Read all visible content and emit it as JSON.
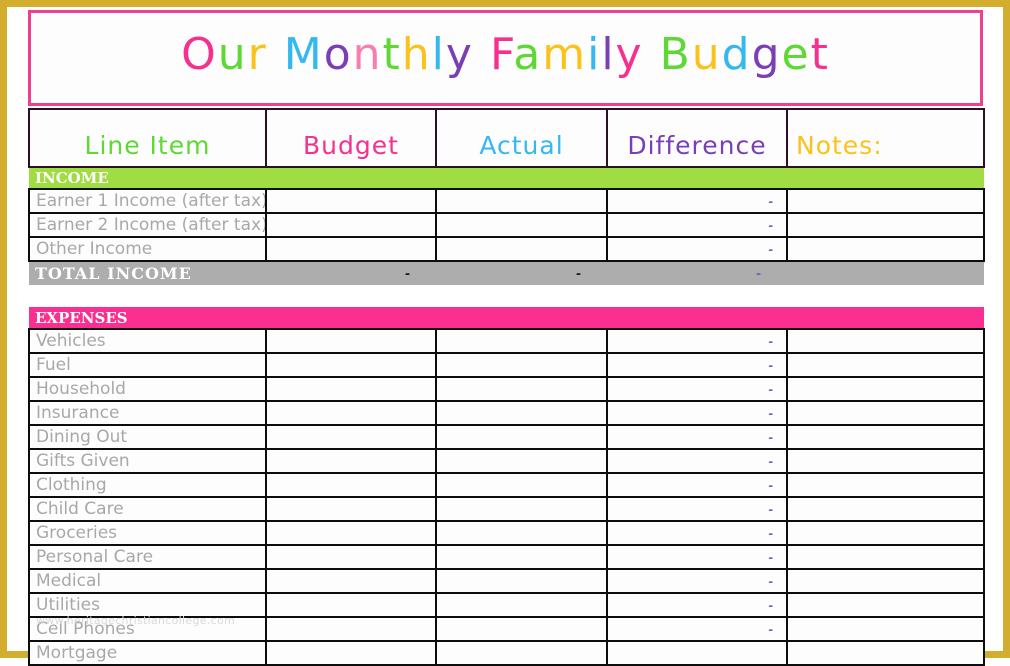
{
  "title": {
    "full_text": "Our Monthly Family Budget",
    "letters": [
      {
        "ch": "O",
        "color": "#f5308f"
      },
      {
        "ch": "u",
        "color": "#5fd836"
      },
      {
        "ch": "r",
        "color": "#fbc21c"
      },
      {
        "ch": " ",
        "color": "#ffffff"
      },
      {
        "ch": "M",
        "color": "#35b8ef"
      },
      {
        "ch": "o",
        "color": "#7b3fb5"
      },
      {
        "ch": "n",
        "color": "#f77fb0"
      },
      {
        "ch": "t",
        "color": "#5fd836"
      },
      {
        "ch": "h",
        "color": "#fbc21c"
      },
      {
        "ch": "l",
        "color": "#35b8ef"
      },
      {
        "ch": "y",
        "color": "#7b3fb5"
      },
      {
        "ch": " ",
        "color": "#ffffff"
      },
      {
        "ch": "F",
        "color": "#f5308f"
      },
      {
        "ch": "a",
        "color": "#5fd836"
      },
      {
        "ch": "m",
        "color": "#fbc21c"
      },
      {
        "ch": "i",
        "color": "#35b8ef"
      },
      {
        "ch": "l",
        "color": "#7b3fb5"
      },
      {
        "ch": "y",
        "color": "#f5308f"
      },
      {
        "ch": " ",
        "color": "#ffffff"
      },
      {
        "ch": "B",
        "color": "#5fd836"
      },
      {
        "ch": "u",
        "color": "#fbc21c"
      },
      {
        "ch": "d",
        "color": "#35b8ef"
      },
      {
        "ch": "g",
        "color": "#7b3fb5"
      },
      {
        "ch": "e",
        "color": "#5fd836"
      },
      {
        "ch": "t",
        "color": "#f5308f"
      }
    ]
  },
  "columns": [
    {
      "key": "line_item",
      "label": "Line Item",
      "color": "#5fd836"
    },
    {
      "key": "budget",
      "label": "Budget",
      "color": "#f5308f"
    },
    {
      "key": "actual",
      "label": "Actual",
      "color": "#35b8ef"
    },
    {
      "key": "difference",
      "label": "Difference",
      "color": "#7b3fb5"
    },
    {
      "key": "notes",
      "label": "Notes:",
      "color": "#fbc21c"
    }
  ],
  "sections": [
    {
      "key": "income",
      "banner": "INCOME",
      "banner_bg": "#9fdd42",
      "rows": [
        {
          "item": "Earner 1 Income (after tax)",
          "budget": "",
          "actual": "",
          "difference": "-",
          "notes": ""
        },
        {
          "item": "Earner 2 Income (after tax)",
          "budget": "",
          "actual": "",
          "difference": "-",
          "notes": ""
        },
        {
          "item": "Other Income",
          "budget": "",
          "actual": "",
          "difference": "-",
          "notes": ""
        }
      ],
      "total": {
        "label": "TOTAL  INCOME",
        "budget": "-",
        "actual": "-",
        "difference": "-",
        "bg": "#adadad"
      }
    },
    {
      "key": "expenses",
      "banner": "EXPENSES",
      "banner_bg": "#fb2f8f",
      "rows": [
        {
          "item": "Vehicles",
          "budget": "",
          "actual": "",
          "difference": "-",
          "notes": ""
        },
        {
          "item": "Fuel",
          "budget": "",
          "actual": "",
          "difference": "-",
          "notes": ""
        },
        {
          "item": "Household",
          "budget": "",
          "actual": "",
          "difference": "-",
          "notes": ""
        },
        {
          "item": "Insurance",
          "budget": "",
          "actual": "",
          "difference": "-",
          "notes": ""
        },
        {
          "item": "Dining Out",
          "budget": "",
          "actual": "",
          "difference": "-",
          "notes": ""
        },
        {
          "item": "Gifts Given",
          "budget": "",
          "actual": "",
          "difference": "-",
          "notes": ""
        },
        {
          "item": "Clothing",
          "budget": "",
          "actual": "",
          "difference": "-",
          "notes": ""
        },
        {
          "item": "Child Care",
          "budget": "",
          "actual": "",
          "difference": "-",
          "notes": ""
        },
        {
          "item": "Groceries",
          "budget": "",
          "actual": "",
          "difference": "-",
          "notes": ""
        },
        {
          "item": "Personal Care",
          "budget": "",
          "actual": "",
          "difference": "-",
          "notes": ""
        },
        {
          "item": "Medical",
          "budget": "",
          "actual": "",
          "difference": "-",
          "notes": ""
        },
        {
          "item": "Utilities",
          "budget": "",
          "actual": "",
          "difference": "-",
          "notes": ""
        },
        {
          "item": "Cell Phones",
          "budget": "",
          "actual": "",
          "difference": "-",
          "notes": ""
        },
        {
          "item": "Mortgage",
          "budget": "",
          "actual": "",
          "difference": "",
          "notes": ""
        }
      ]
    }
  ],
  "watermark": "www.heritagechristiancollege.com",
  "frame": {
    "border_color": "#d3ae2e",
    "title_border_color": "#ef3f8f"
  }
}
